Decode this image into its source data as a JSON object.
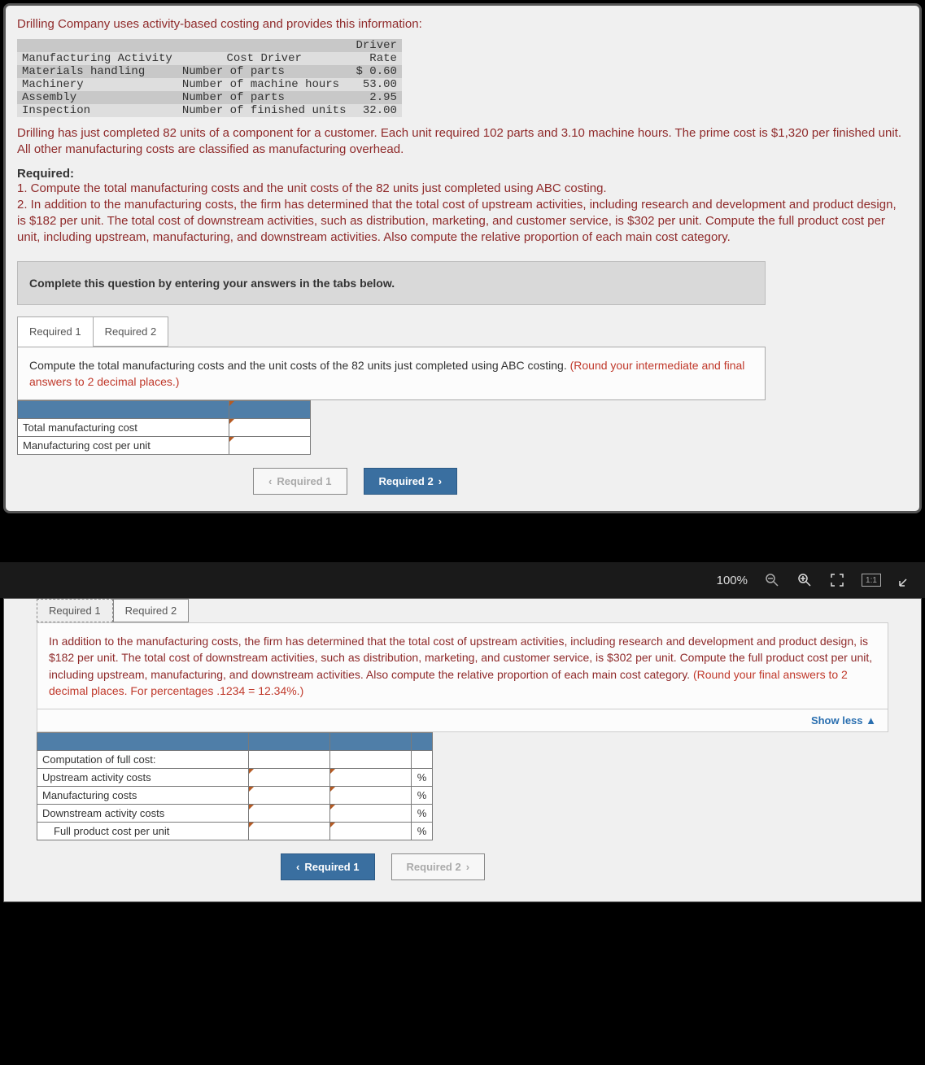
{
  "intro": "Drilling Company uses activity-based costing and provides this information:",
  "table": {
    "h1": "Manufacturing Activity",
    "h2": "Cost Driver",
    "h3": "Driver",
    "h4": "Rate",
    "rows": [
      {
        "a": "Materials handling",
        "b": "Number of parts",
        "c": "$ 0.60"
      },
      {
        "a": "Machinery",
        "b": "Number of machine hours",
        "c": "53.00"
      },
      {
        "a": "Assembly",
        "b": "Number of parts",
        "c": "2.95"
      },
      {
        "a": "Inspection",
        "b": "Number of finished units",
        "c": "32.00"
      }
    ]
  },
  "para1": "Drilling has just completed 82 units of a component for a customer. Each unit required 102 parts and 3.10 machine hours. The prime cost is $1,320 per finished unit. All other manufacturing costs are classified as manufacturing overhead.",
  "reqHdr": "Required:",
  "req1": "1. Compute the total manufacturing costs and the unit costs of the 82 units just completed using ABC costing.",
  "req2": "2. In addition to the manufacturing costs, the firm has determined that the total cost of upstream activities, including research and development and product design, is $182 per unit. The total cost of downstream activities, such as distribution, marketing, and customer service, is $302 per unit. Compute the full product cost per unit, including upstream, manufacturing, and downstream activities. Also compute the relative proportion of each main cost category.",
  "band": "Complete this question by entering your answers in the tabs below.",
  "tabs": {
    "t1": "Required 1",
    "t2": "Required 2"
  },
  "box1": {
    "black": "Compute the total manufacturing costs and the unit costs of the 82 units just completed using ABC costing. ",
    "red": "(Round your intermediate and final answers to 2 decimal places.)"
  },
  "ans1": {
    "r1": "Total manufacturing cost",
    "r2": "Manufacturing cost per unit"
  },
  "nav": {
    "prev": "Required 1",
    "next": "Required 2"
  },
  "toolbar": {
    "zoom": "100%",
    "ratio": "1:1"
  },
  "p2": {
    "text": "In addition to the manufacturing costs, the firm has determined that the total cost of upstream activities, including research and development and product design, is $182 per unit. The total cost of downstream activities, such as distribution, marketing, and customer service, is $302 per unit. Compute the full product cost per unit, including upstream, manufacturing, and downstream activities. Also compute the relative proportion of each main cost category. ",
    "red": "(Round your final answers to 2 decimal places. For percentages .1234 = 12.34%.)",
    "showless": "Show less",
    "rows": {
      "h": "Computation of full cost:",
      "r1": "Upstream activity costs",
      "r2": "Manufacturing costs",
      "r3": "Downstream activity costs",
      "r4": "Full product cost per unit"
    },
    "pct": "%"
  }
}
